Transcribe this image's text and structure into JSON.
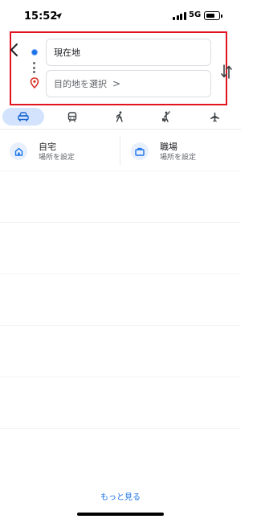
{
  "status_bar": {
    "time": "15:52",
    "network": "5G"
  },
  "search": {
    "origin_value": "現在地",
    "destination_placeholder": "目的地を選択",
    "destination_chevron": ">"
  },
  "travel_modes": [
    {
      "name": "car",
      "icon": "car-icon",
      "active": true
    },
    {
      "name": "transit",
      "icon": "train-icon",
      "active": false
    },
    {
      "name": "walk",
      "icon": "walk-icon",
      "active": false
    },
    {
      "name": "ride",
      "icon": "hail-icon",
      "active": false
    },
    {
      "name": "flight",
      "icon": "plane-icon",
      "active": false
    }
  ],
  "shortcuts": {
    "home": {
      "title": "自宅",
      "subtitle": "場所を設定",
      "icon": "home-icon"
    },
    "work": {
      "title": "職場",
      "subtitle": "場所を設定",
      "icon": "briefcase-icon"
    }
  },
  "footer": {
    "more_label": "もっと見る"
  },
  "colors": {
    "accent": "#1a73e8",
    "highlight_border": "#e0131f",
    "active_tab": "#d3e3fd",
    "pin": "#d93025"
  }
}
